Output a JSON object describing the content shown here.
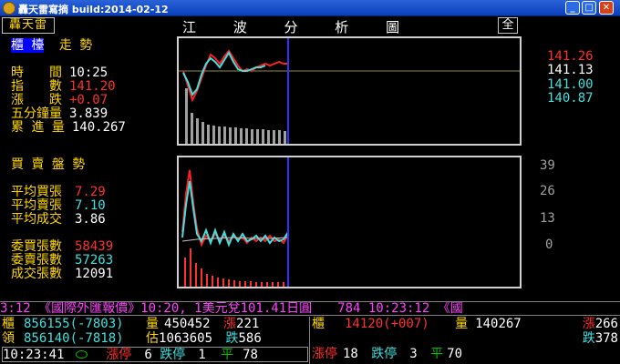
{
  "window": {
    "title": "轟天雷寫摘 build:2014-02-12",
    "buttons": [
      "_",
      "□",
      "✕"
    ]
  },
  "header": {
    "logo": "轟天雷",
    "title": "江 波 分 析 圖",
    "all_label": "全"
  },
  "trend_panel": {
    "title_highlight": "櫃 檯",
    "title_rest": "走 勢",
    "rows": [
      {
        "label": "時　　間",
        "value": "10:25",
        "value_color": "white"
      },
      {
        "label": "指　　數",
        "value": "141.20",
        "value_color": "red"
      },
      {
        "label": "漲　　跌",
        "value": "+0.07",
        "value_color": "red"
      },
      {
        "label": "五分鐘量",
        "value": "3.839",
        "value_color": "white"
      },
      {
        "label": "累 進 量",
        "value": "140.267",
        "value_color": "white"
      }
    ]
  },
  "top_axis": [
    "141.26",
    "141.13",
    "141.00",
    "140.87"
  ],
  "buysell_panel": {
    "title": "買 賣 盤 勢",
    "rows": [
      {
        "label": "平均買張",
        "value": "7.29",
        "value_color": "red"
      },
      {
        "label": "平均賣張",
        "value": "7.10",
        "value_color": "cyan"
      },
      {
        "label": "平均成交",
        "value": "3.86",
        "value_color": "white"
      }
    ],
    "totals": [
      {
        "label": "委買張數",
        "value": "58439",
        "value_color": "red"
      },
      {
        "label": "委賣張數",
        "value": "57263",
        "value_color": "cyan"
      },
      {
        "label": "成交張數",
        "value": "12091",
        "value_color": "white"
      }
    ]
  },
  "bottom_axis": [
    "39",
    "26",
    "13",
    "0"
  ],
  "ticker": "3:12 《國際外匯報價》10:20, 1美元兌101.41日圓　　784 10:23:12 《國",
  "status_left": {
    "row1": {
      "a_label": "櫃",
      "a_value": "856155(-7803)",
      "b_label": "量",
      "b_value": "450452",
      "c_label": "漲",
      "c_value": "221"
    },
    "row2": {
      "a_label": "領",
      "a_value": "856140(-7818)",
      "b_label": "估",
      "b_value": "1063605",
      "c_label": "跌",
      "c_value": "586"
    },
    "row3": {
      "time": "10:23:41",
      "up_label": "漲停",
      "up_value": "6",
      "down_label": "跌停",
      "down_value": "1",
      "flat_label": "平",
      "flat_value": "78"
    }
  },
  "status_right": {
    "row1": {
      "a_label": "櫃",
      "a_value": "14120(+007)",
      "b_label": "量",
      "b_value": "140267",
      "c_label": "漲",
      "c_value": "266"
    },
    "row2": {
      "c_label": "跌",
      "c_value": "378"
    },
    "row3": {
      "up_label": "漲停",
      "up_value": "18",
      "down_label": "跌停",
      "down_value": "3",
      "flat_label": "平",
      "flat_value": "70"
    }
  },
  "colors": {
    "red": "#ff3030",
    "cyan": "#40e0e0",
    "yellow": "#ffd700",
    "magenta": "#ff40ff",
    "blue": "#0000ff",
    "green": "#00c000"
  }
}
